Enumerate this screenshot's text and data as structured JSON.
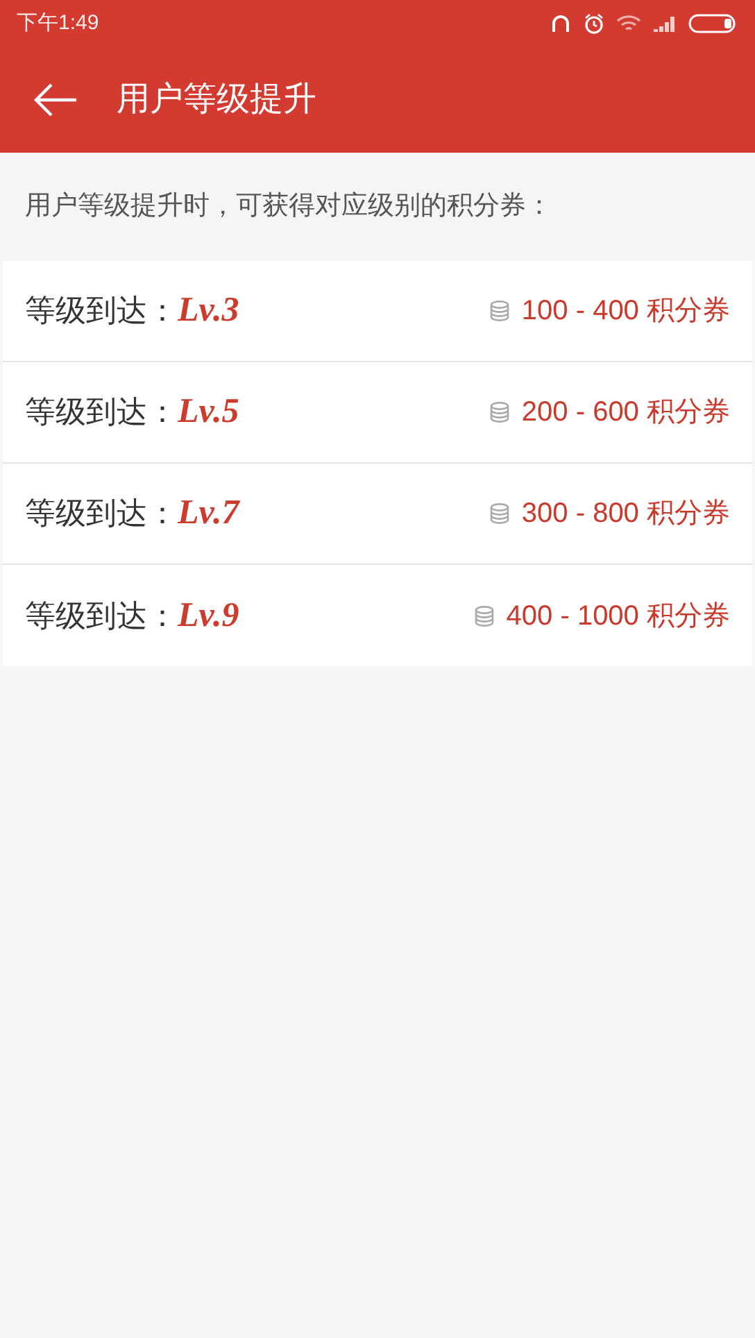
{
  "status_bar": {
    "time": "下午1:49"
  },
  "header": {
    "title": "用户等级提升"
  },
  "intro": "用户等级提升时，可获得对应级别的积分券：",
  "levels": [
    {
      "label": "等级到达：",
      "level": "Lv.3",
      "reward": "100 - 400 积分券"
    },
    {
      "label": "等级到达：",
      "level": "Lv.5",
      "reward": "200 - 600 积分券"
    },
    {
      "label": "等级到达：",
      "level": "Lv.7",
      "reward": "300 - 800 积分券"
    },
    {
      "label": "等级到达：",
      "level": "Lv.9",
      "reward": "400 - 1000 积分券"
    }
  ]
}
